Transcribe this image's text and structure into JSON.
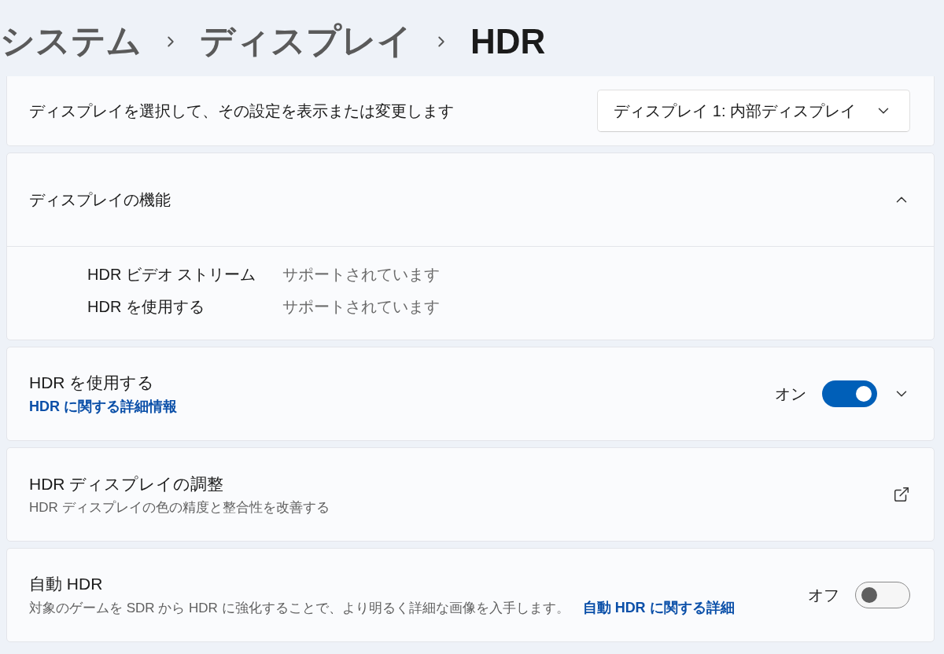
{
  "breadcrumb": [
    {
      "label": "システム",
      "current": false
    },
    {
      "label": "ディスプレイ",
      "current": false
    },
    {
      "label": "HDR",
      "current": true
    }
  ],
  "display_selector": {
    "label": "ディスプレイを選択して、その設定を表示または変更します",
    "value": "ディスプレイ 1: 内部ディスプレイ"
  },
  "capabilities": {
    "title": "ディスプレイの機能",
    "expanded": true,
    "items": [
      {
        "name": "HDR ビデオ ストリーム",
        "value": "サポートされています"
      },
      {
        "name": "HDR を使用する",
        "value": "サポートされています"
      }
    ]
  },
  "settings": [
    {
      "kind": "toggle",
      "title": "HDR を使用する",
      "link": "HDR に関する詳細情報",
      "toggle_label": "オン",
      "on": true,
      "expanded": false
    },
    {
      "kind": "external",
      "title": "HDR ディスプレイの調整",
      "description": "HDR ディスプレイの色の精度と整合性を改善する"
    },
    {
      "kind": "toggle",
      "title": "自動 HDR",
      "description": "対象のゲームを SDR から HDR に強化することで、より明るく詳細な画像を入手します。",
      "inline_link": "自動 HDR に関する詳細",
      "toggle_label": "オフ",
      "on": false
    }
  ]
}
